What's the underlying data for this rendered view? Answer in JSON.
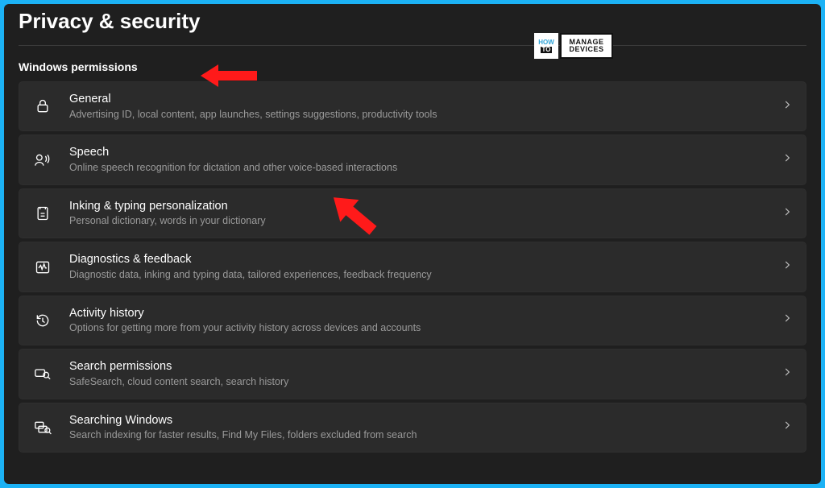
{
  "page": {
    "title": "Privacy & security",
    "section_header": "Windows permissions"
  },
  "items": [
    {
      "icon": "lock-icon",
      "title": "General",
      "subtitle": "Advertising ID, local content, app launches, settings suggestions, productivity tools"
    },
    {
      "icon": "speech-icon",
      "title": "Speech",
      "subtitle": "Online speech recognition for dictation and other voice-based interactions"
    },
    {
      "icon": "inking-icon",
      "title": "Inking & typing personalization",
      "subtitle": "Personal dictionary, words in your dictionary"
    },
    {
      "icon": "diagnostics-icon",
      "title": "Diagnostics & feedback",
      "subtitle": "Diagnostic data, inking and typing data, tailored experiences, feedback frequency"
    },
    {
      "icon": "history-icon",
      "title": "Activity history",
      "subtitle": "Options for getting more from your activity history across devices and accounts"
    },
    {
      "icon": "search-permissions-icon",
      "title": "Search permissions",
      "subtitle": "SafeSearch, cloud content search, search history"
    },
    {
      "icon": "searching-windows-icon",
      "title": "Searching Windows",
      "subtitle": "Search indexing for faster results, Find My Files, folders excluded from search"
    }
  ],
  "watermark": {
    "line1": "HOW",
    "line2": "TO",
    "line3": "MANAGE",
    "line4": "DEVICES"
  }
}
